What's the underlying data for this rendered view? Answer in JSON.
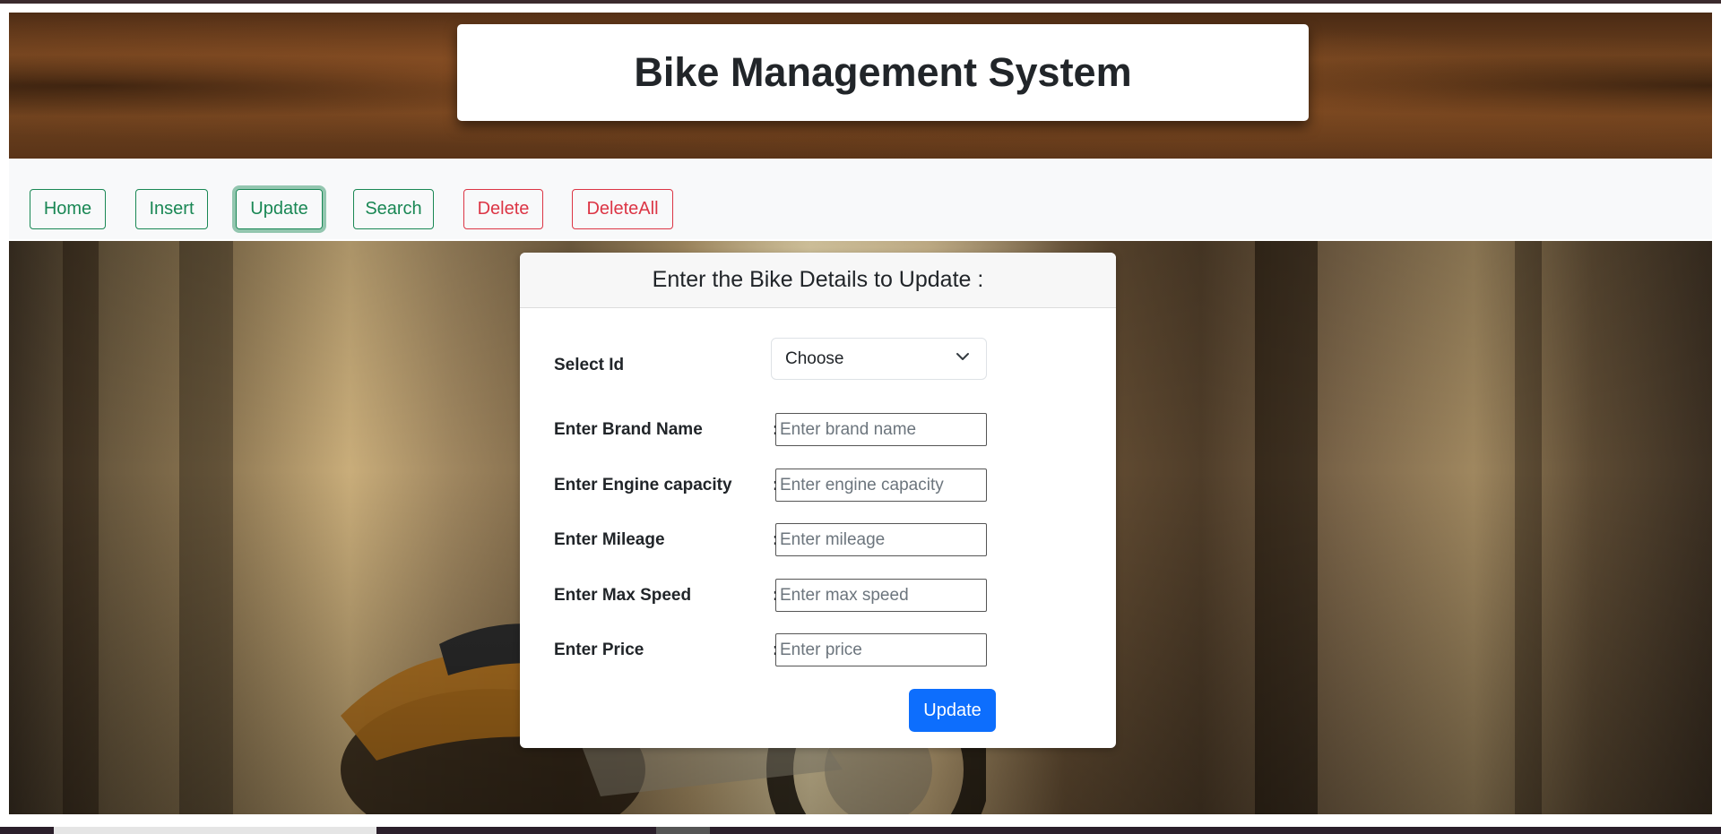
{
  "header": {
    "title": "Bike Management System"
  },
  "nav": {
    "items": [
      {
        "label": "Home",
        "variant": "success"
      },
      {
        "label": "Insert",
        "variant": "success"
      },
      {
        "label": "Update",
        "variant": "success",
        "active": true
      },
      {
        "label": "Search",
        "variant": "success"
      },
      {
        "label": "Delete",
        "variant": "danger"
      },
      {
        "label": "DeleteAll",
        "variant": "danger"
      }
    ]
  },
  "form": {
    "heading": "Enter the Bike Details to Update :",
    "colon": ":",
    "select_id": {
      "label": "Select Id",
      "value": "Choose"
    },
    "fields": [
      {
        "label": "Enter Brand Name",
        "placeholder": "Enter brand name"
      },
      {
        "label": "Enter Engine capacity",
        "placeholder": "Enter engine capacity"
      },
      {
        "label": "Enter Mileage",
        "placeholder": "Enter mileage"
      },
      {
        "label": "Enter Max Speed",
        "placeholder": "Enter max speed"
      },
      {
        "label": "Enter Price",
        "placeholder": "Enter price"
      }
    ],
    "submit_label": "Update"
  },
  "colors": {
    "success": "#198754",
    "danger": "#dc3545",
    "primary": "#0d6efd",
    "navbar_bg": "#f8f9fa"
  },
  "icons": {
    "select": "chevron-down-icon"
  }
}
